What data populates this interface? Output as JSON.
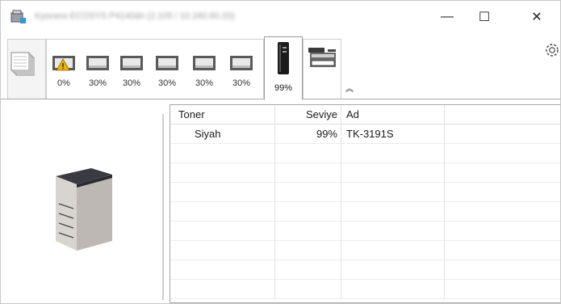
{
  "window": {
    "title": "Kyocera ECOSYS P4140dn (2.105 / 10.160.60.20)",
    "minimize": "—",
    "maximize": "☐",
    "close": "✕"
  },
  "toolbar": {
    "trays": [
      {
        "level": "0%",
        "warning": true
      },
      {
        "level": "30%",
        "warning": false
      },
      {
        "level": "30%",
        "warning": false
      },
      {
        "level": "30%",
        "warning": false
      },
      {
        "level": "30%",
        "warning": false
      },
      {
        "level": "30%",
        "warning": false
      }
    ],
    "toner_level": "99%",
    "collapse_glyph": "︽"
  },
  "table": {
    "headers": {
      "toner": "Toner",
      "level": "Seviye",
      "name": "Ad"
    },
    "rows": [
      {
        "toner": "Siyah",
        "level": "99%",
        "name": "TK-3191S"
      }
    ]
  },
  "icons": {
    "app": "printer-app-icon",
    "document_tab": "document-stack-icon",
    "paper_tray": "paper-tray-icon",
    "toner_tab": "toner-cartridge-icon",
    "scan_tab": "scanner-icon",
    "settings": "gear-icon"
  },
  "colors": {
    "warning": "#f0b400",
    "tray_dark": "#5a5a5a",
    "border": "#a9a9a9"
  }
}
